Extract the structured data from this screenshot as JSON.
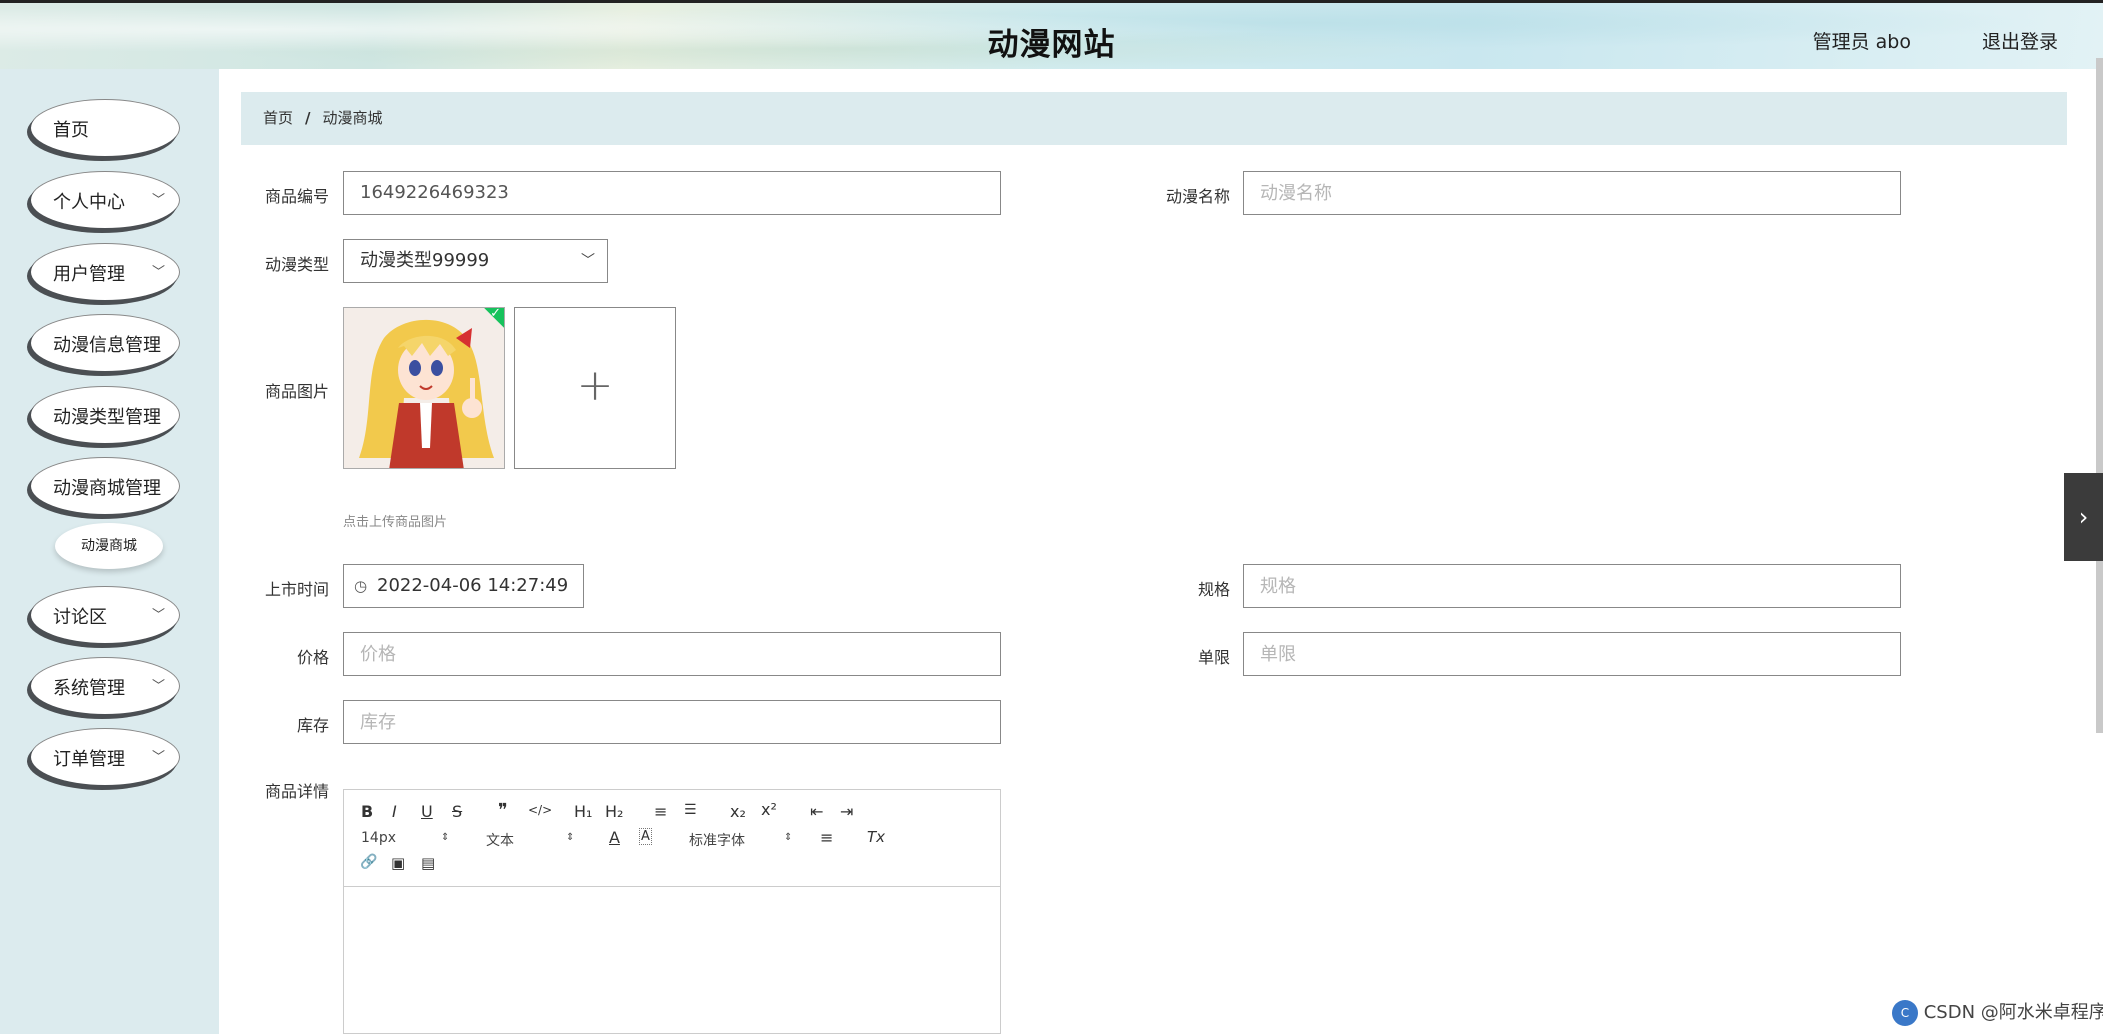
{
  "header": {
    "title": "动漫网站",
    "user": "管理员 abo",
    "logout": "退出登录"
  },
  "sidebar": {
    "items": [
      {
        "label": "首页",
        "chevron": false
      },
      {
        "label": "个人中心",
        "chevron": true
      },
      {
        "label": "用户管理",
        "chevron": true
      },
      {
        "label": "动漫信息管理",
        "chevron": false
      },
      {
        "label": "动漫类型管理",
        "chevron": false
      },
      {
        "label": "动漫商城管理",
        "chevron": false
      },
      {
        "label": "讨论区",
        "chevron": true
      },
      {
        "label": "系统管理",
        "chevron": true
      },
      {
        "label": "订单管理",
        "chevron": true
      }
    ],
    "sub_item": "动漫商城"
  },
  "breadcrumb": {
    "home": "首页",
    "separator": "/",
    "current": "动漫商城"
  },
  "form": {
    "product_no": {
      "label": "商品编号",
      "value": "1649226469323"
    },
    "anime_name": {
      "label": "动漫名称",
      "placeholder": "动漫名称"
    },
    "anime_type": {
      "label": "动漫类型",
      "value": "动漫类型99999"
    },
    "product_image": {
      "label": "商品图片",
      "upload_icon": "+",
      "hint": "点击上传商品图片"
    },
    "release_time": {
      "label": "上市时间",
      "value": "2022-04-06 14:27:49"
    },
    "spec": {
      "label": "规格",
      "placeholder": "规格"
    },
    "price": {
      "label": "价格",
      "placeholder": "价格"
    },
    "limit": {
      "label": "单限",
      "placeholder": "单限"
    },
    "stock": {
      "label": "库存",
      "placeholder": "库存"
    },
    "detail": {
      "label": "商品详情"
    }
  },
  "editor": {
    "font_size": "14px",
    "paragraph": "文本",
    "font_family": "标准字体",
    "buttons": {
      "bold": "B",
      "italic": "I",
      "underline": "U",
      "strike": "S",
      "quote": "❞",
      "code": "</>",
      "h1": "H₁",
      "h2": "H₂",
      "ordered_list": "≡",
      "bullet_list": "☰",
      "subscript": "x₂",
      "superscript": "x²",
      "outdent": "⇤",
      "indent": "⇥",
      "font_color": "A",
      "background": "A",
      "align": "≡",
      "clean": "Tx",
      "link": "🔗",
      "image": "▣",
      "video": "▤"
    }
  },
  "watermark": "CSDN @阿水米卓程序",
  "colors": {
    "sidebar_bg": "#dcebee",
    "breadcrumb_bg": "#dcebee",
    "pill_shadow": "#4b4f53",
    "upload_ok": "#16c25c"
  }
}
